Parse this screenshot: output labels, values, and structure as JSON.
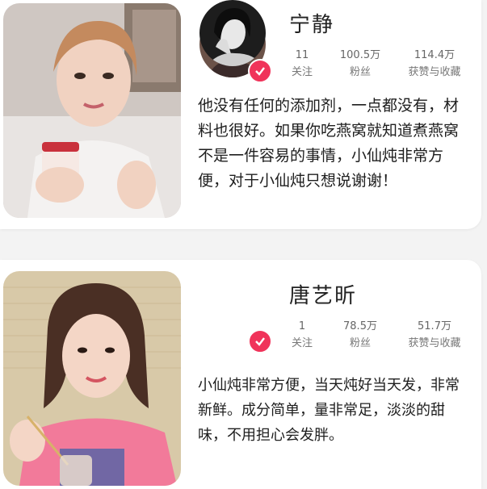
{
  "cards": [
    {
      "name": "宁静",
      "stats": [
        {
          "value": "11",
          "label": "关注"
        },
        {
          "value": "100.5万",
          "label": "粉丝"
        },
        {
          "value": "114.4万",
          "label": "获赞与收藏"
        }
      ],
      "quote": "他没有任何的添加剂，一点都没有，材料也很好。如果你吃燕窝就知道煮燕窝不是一件容易的事情，小仙炖非常方便，对于小仙炖只想说谢谢！"
    },
    {
      "name": "唐艺昕",
      "stats": [
        {
          "value": "1",
          "label": "关注"
        },
        {
          "value": "78.5万",
          "label": "粉丝"
        },
        {
          "value": "51.7万",
          "label": "获赞与收藏"
        }
      ],
      "quote": "小仙炖非常方便，当天炖好当天发，非常新鲜。成分简单，量非常足，淡淡的甜味，不用担心会发胖。"
    }
  ],
  "colors": {
    "verified": "#f0335a",
    "background": "#f3f3f3"
  }
}
